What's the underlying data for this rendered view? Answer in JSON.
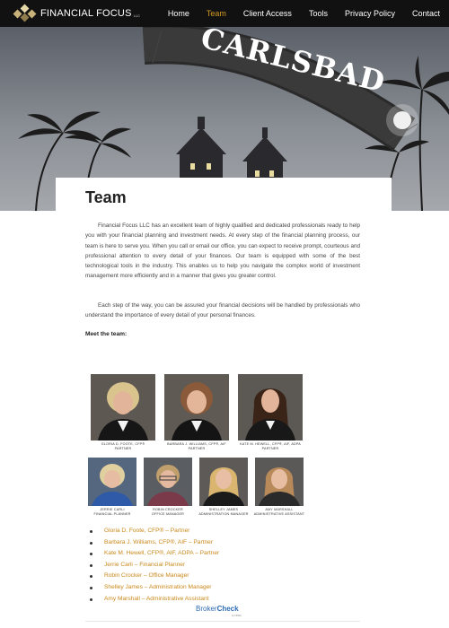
{
  "header": {
    "brand": "FINANCIAL FOCUS",
    "brand_suffix": "LLC",
    "nav": [
      {
        "label": "Home",
        "active": false
      },
      {
        "label": "Team",
        "active": true
      },
      {
        "label": "Client Access",
        "active": false
      },
      {
        "label": "Tools",
        "active": false
      },
      {
        "label": "Privacy Policy",
        "active": false
      },
      {
        "label": "Contact",
        "active": false
      }
    ]
  },
  "hero": {
    "sign_text": "CARLSBAD"
  },
  "main": {
    "title": "Team",
    "paragraphs": [
      "Financial Focus LLC has an excellent team of highly qualified and dedicated professionals ready to help you with your financial planning and investment needs. At every step of the financial planning process, our team is here to serve you. When you call or email our office, you can expect to receive prompt, courteous and professional attention to every detail of your finances. Our team is equipped with some of the best technological tools in the industry. This enables us to help you navigate the complex world of investment management more efficiently and in a manner that gives you greater control.",
      "Each step of the way, you can be assured your financial decisions will be handled by professionals who understand the importance of every detail of your personal finances."
    ],
    "meet_heading": "Meet the team:",
    "photos": [
      {
        "name": "GLORIA D. FOOTE, CFP®",
        "role": "PARTNER"
      },
      {
        "name": "BARBARA J. WILLIAMS, CFP®, AIF",
        "role": "PARTNER"
      },
      {
        "name": "KATE M. HEWELL, CFP®, AIF, ADPA",
        "role": "PARTNER"
      },
      {
        "name": "JERRIE CARLI",
        "role": "FINANCIAL PLANNER"
      },
      {
        "name": "ROBIN CROCKER",
        "role": "OFFICE MANAGER"
      },
      {
        "name": "SHELLEY JAMES",
        "role": "ADMINISTRATION MANAGER"
      },
      {
        "name": "AMY MARSHALL",
        "role": "ADMINISTRATIVE ASSISTANT"
      }
    ],
    "team_list": [
      "Gloria D. Foote, CFP® – Partner",
      "Barbara J. Williams, CFP®, AIF – Partner",
      "Kate M. Hewell, CFP®, AIF, ADPA – Partner",
      "Jerrie Carli – Financial Planner",
      "Robin Crocker – Office Manager",
      "Shelley James – Administration Manager",
      "Amy Marshall – Administrative Assistant"
    ]
  },
  "footer": {
    "broker_prefix": "Broker",
    "broker_suffix": "Check",
    "broker_sub": "by FINRA"
  },
  "colors": {
    "nav_bg": "#111111",
    "accent": "#d59b22",
    "link": "#c9881a",
    "brokercheck": "#2e6db4"
  }
}
